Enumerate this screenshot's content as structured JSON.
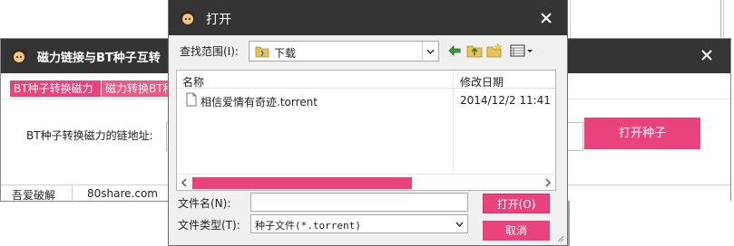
{
  "colors": {
    "accent": "#e9437d",
    "titlebar": "#343434"
  },
  "main_window": {
    "title": "磁力链接与BT种子互转",
    "tabs": [
      {
        "label": "BT种子转换磁力"
      },
      {
        "label": "磁力转换BT种"
      }
    ],
    "field_label": "BT种子转换磁力的链地址:",
    "field_value": "",
    "open_button": "打开种子",
    "status": {
      "left": "吾爱破解",
      "right": "80share.com"
    }
  },
  "dialog": {
    "title": "打开",
    "look_in_label": "查找范围(I):",
    "look_in_value": "下载",
    "columns": {
      "name": "名称",
      "date": "修改日期"
    },
    "files": [
      {
        "name": "相信爱情有奇迹.torrent",
        "date": "2014/12/2 11:41",
        "icon": "document-icon"
      }
    ],
    "filename_label": "文件名(N):",
    "filename_value": "",
    "filetype_label": "文件类型(T):",
    "filetype_value": "种子文件(*.torrent)",
    "open_button": "打开(O)",
    "cancel_button": "取消"
  }
}
